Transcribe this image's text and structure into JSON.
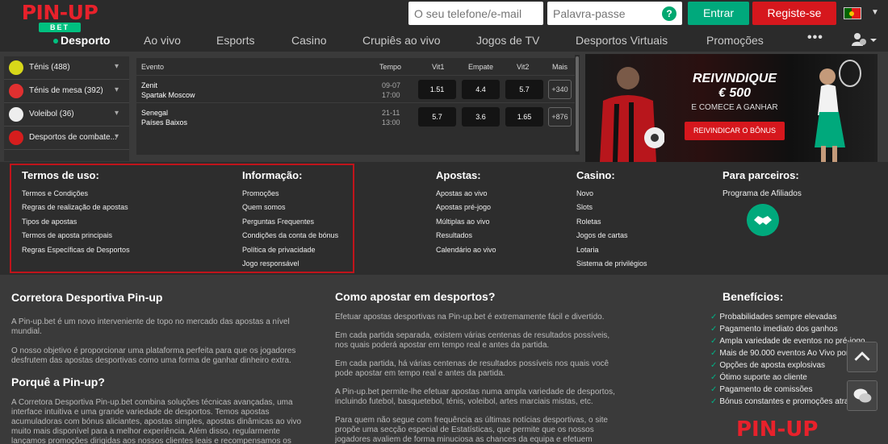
{
  "brand": {
    "logo_text": "PIN-UP",
    "logo_sub": "BET",
    "primary_tab": "Desporto",
    "accent": "#00a97c",
    "red": "#d6171d"
  },
  "header": {
    "phone_placeholder": "O seu telefone/e-mail",
    "password_placeholder": "Palavra-passe",
    "help_icon": "?",
    "login_label": "Entrar",
    "register_label": "Registe-se",
    "more_label": "•••"
  },
  "nav": [
    "Ao vivo",
    "Esports",
    "Casino",
    "Crupiês ao vivo",
    "Jogos de TV",
    "Desportos Virtuais",
    "Promoções"
  ],
  "sidebar": {
    "items": [
      {
        "label": "Ténis (488)",
        "icon": "tennis-ball-icon",
        "color": "#d8d81a"
      },
      {
        "label": "Ténis de mesa (392)",
        "icon": "table-tennis-icon",
        "color": "#e03030"
      },
      {
        "label": "Voleibol (36)",
        "icon": "volleyball-icon",
        "color": "#eeeeee"
      },
      {
        "label": "Desportos de combate...",
        "icon": "combat-sports-icon",
        "color": "#d61d1d"
      }
    ]
  },
  "events": {
    "headers": {
      "event": "Evento",
      "time": "Tempo",
      "w1": "Vit1",
      "draw": "Empate",
      "w2": "Vit2",
      "more": "Mais"
    },
    "rows": [
      {
        "team1": "Zenit",
        "team2": "Spartak Moscow",
        "date": "09-07",
        "time": "17:00",
        "w1": "1.51",
        "draw": "4.4",
        "w2": "5.7",
        "more": "+340"
      },
      {
        "team1": "Senegal",
        "team2": "Países Baixos",
        "date": "21-11",
        "time": "13:00",
        "w1": "5.7",
        "draw": "3.6",
        "w2": "1.65",
        "more": "+876"
      }
    ]
  },
  "banner": {
    "title": "REIVINDIQUE",
    "amount": "€ 500",
    "subtitle": "E COMECE A GANHAR",
    "button": "REIVINDICAR O BÔNUS"
  },
  "footer": {
    "terms": {
      "title": "Termos de uso:",
      "links": [
        "Termos e Condições",
        "Regras de realização de apostas",
        "Tipos de apostas",
        "Termos de aposta principais",
        "Regras Específicas de Desportos"
      ]
    },
    "info": {
      "title": "Informação:",
      "links": [
        "Promoções",
        "Quem somos",
        "Perguntas Frequentes",
        "Condições da conta de bónus",
        "Política de privacidade",
        "Jogo responsável"
      ]
    },
    "bets": {
      "title": "Apostas:",
      "links": [
        "Apostas ao vivo",
        "Apostas pré-jogo",
        "Múltiplas ao vivo",
        "Resultados",
        "Calendário ao vivo"
      ]
    },
    "casino": {
      "title": "Casino:",
      "links": [
        "Novo",
        "Slots",
        "Roletas",
        "Jogos de cartas",
        "Lotaria",
        "Sistema de privilégios"
      ]
    },
    "partners": {
      "title": "Para parceiros:",
      "links": [
        "Programa de Afiliados"
      ]
    }
  },
  "seo": {
    "h1": "Corretora Desportiva Pin-up",
    "p1": "A Pin-up.bet é um novo interveniente de topo no mercado das apostas a nível mundial.",
    "p2": "O nosso objetivo é proporcionar uma plataforma perfeita para que os jogadores desfrutem das apostas desportivas como uma forma de ganhar dinheiro extra.",
    "h2": "Porquê a Pin-up?",
    "p3": "A Corretora Desportiva Pin-up.bet combina soluções técnicas avançadas, uma interface intuitiva e uma grande variedade de desportos. Temos apostas acumuladoras com bónus aliciantes, apostas simples, apostas dinâmicas ao vivo muito mais disponível para a melhor experiência. Além disso, regularmente lançamos promoções dirigidas aos nossos clientes leais e recompensamos os",
    "h3": "Como apostar em desportos?",
    "q1": "Efetuar apostas desportivas na Pin-up.bet é extremamente fácil e divertido.",
    "q2": "Em cada partida separada, existem várias centenas de resultados possíveis, nos quais poderá apostar em tempo real e antes da partida.",
    "q3": "Em cada partida, há várias centenas de resultados possíveis nos quais você pode apostar em tempo real e antes da partida.",
    "q4": "A Pin-up.bet permite-lhe efetuar apostas numa ampla variedade de desportos, incluindo futebol, basquetebol, ténis, voleibol, artes marciais mistas, etc.",
    "q5": "Para quem não segue com frequência as últimas notícias desportivas, o site propõe uma secção especial de Estatísticas, que permite que os nossos jogadores avaliem de forma minuciosa as chances da equipa e efetuem",
    "h4": "Benefícios:",
    "benefits": [
      "Probabilidades sempre elevadas",
      "Pagamento imediato dos ganhos",
      "Ampla variedade de eventos no pré-jogo",
      "Mais de 90.000 eventos Ao Vivo por mês",
      "Opções de aposta explosivas",
      "Ótimo suporte ao cliente",
      "Pagamento de comissões",
      "Bónus constantes e promoções atraentes"
    ],
    "footer_logo": "PIN-UP"
  }
}
